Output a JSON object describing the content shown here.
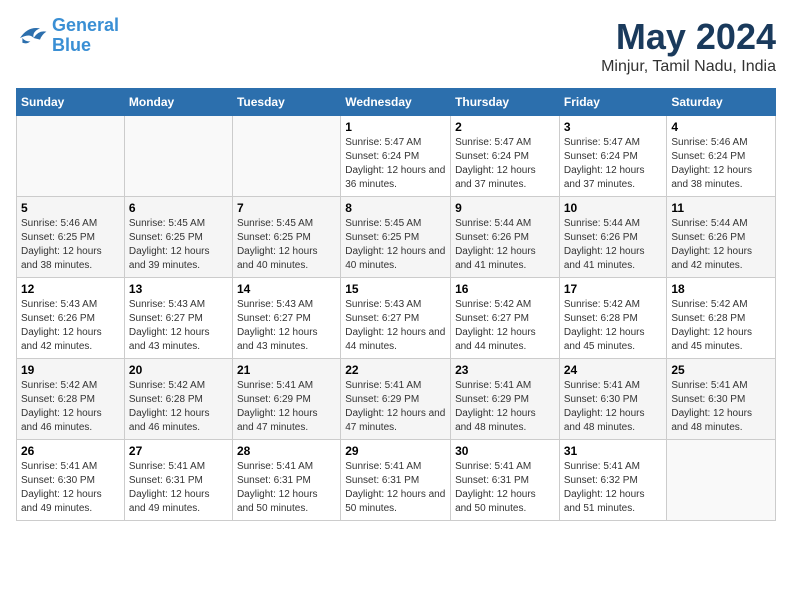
{
  "header": {
    "logo_line1": "General",
    "logo_line2": "Blue",
    "main_title": "May 2024",
    "subtitle": "Minjur, Tamil Nadu, India"
  },
  "weekdays": [
    "Sunday",
    "Monday",
    "Tuesday",
    "Wednesday",
    "Thursday",
    "Friday",
    "Saturday"
  ],
  "weeks": [
    [
      {
        "day": "",
        "sunrise": "",
        "sunset": "",
        "daylight": ""
      },
      {
        "day": "",
        "sunrise": "",
        "sunset": "",
        "daylight": ""
      },
      {
        "day": "",
        "sunrise": "",
        "sunset": "",
        "daylight": ""
      },
      {
        "day": "1",
        "sunrise": "Sunrise: 5:47 AM",
        "sunset": "Sunset: 6:24 PM",
        "daylight": "Daylight: 12 hours and 36 minutes."
      },
      {
        "day": "2",
        "sunrise": "Sunrise: 5:47 AM",
        "sunset": "Sunset: 6:24 PM",
        "daylight": "Daylight: 12 hours and 37 minutes."
      },
      {
        "day": "3",
        "sunrise": "Sunrise: 5:47 AM",
        "sunset": "Sunset: 6:24 PM",
        "daylight": "Daylight: 12 hours and 37 minutes."
      },
      {
        "day": "4",
        "sunrise": "Sunrise: 5:46 AM",
        "sunset": "Sunset: 6:24 PM",
        "daylight": "Daylight: 12 hours and 38 minutes."
      }
    ],
    [
      {
        "day": "5",
        "sunrise": "Sunrise: 5:46 AM",
        "sunset": "Sunset: 6:25 PM",
        "daylight": "Daylight: 12 hours and 38 minutes."
      },
      {
        "day": "6",
        "sunrise": "Sunrise: 5:45 AM",
        "sunset": "Sunset: 6:25 PM",
        "daylight": "Daylight: 12 hours and 39 minutes."
      },
      {
        "day": "7",
        "sunrise": "Sunrise: 5:45 AM",
        "sunset": "Sunset: 6:25 PM",
        "daylight": "Daylight: 12 hours and 40 minutes."
      },
      {
        "day": "8",
        "sunrise": "Sunrise: 5:45 AM",
        "sunset": "Sunset: 6:25 PM",
        "daylight": "Daylight: 12 hours and 40 minutes."
      },
      {
        "day": "9",
        "sunrise": "Sunrise: 5:44 AM",
        "sunset": "Sunset: 6:26 PM",
        "daylight": "Daylight: 12 hours and 41 minutes."
      },
      {
        "day": "10",
        "sunrise": "Sunrise: 5:44 AM",
        "sunset": "Sunset: 6:26 PM",
        "daylight": "Daylight: 12 hours and 41 minutes."
      },
      {
        "day": "11",
        "sunrise": "Sunrise: 5:44 AM",
        "sunset": "Sunset: 6:26 PM",
        "daylight": "Daylight: 12 hours and 42 minutes."
      }
    ],
    [
      {
        "day": "12",
        "sunrise": "Sunrise: 5:43 AM",
        "sunset": "Sunset: 6:26 PM",
        "daylight": "Daylight: 12 hours and 42 minutes."
      },
      {
        "day": "13",
        "sunrise": "Sunrise: 5:43 AM",
        "sunset": "Sunset: 6:27 PM",
        "daylight": "Daylight: 12 hours and 43 minutes."
      },
      {
        "day": "14",
        "sunrise": "Sunrise: 5:43 AM",
        "sunset": "Sunset: 6:27 PM",
        "daylight": "Daylight: 12 hours and 43 minutes."
      },
      {
        "day": "15",
        "sunrise": "Sunrise: 5:43 AM",
        "sunset": "Sunset: 6:27 PM",
        "daylight": "Daylight: 12 hours and 44 minutes."
      },
      {
        "day": "16",
        "sunrise": "Sunrise: 5:42 AM",
        "sunset": "Sunset: 6:27 PM",
        "daylight": "Daylight: 12 hours and 44 minutes."
      },
      {
        "day": "17",
        "sunrise": "Sunrise: 5:42 AM",
        "sunset": "Sunset: 6:28 PM",
        "daylight": "Daylight: 12 hours and 45 minutes."
      },
      {
        "day": "18",
        "sunrise": "Sunrise: 5:42 AM",
        "sunset": "Sunset: 6:28 PM",
        "daylight": "Daylight: 12 hours and 45 minutes."
      }
    ],
    [
      {
        "day": "19",
        "sunrise": "Sunrise: 5:42 AM",
        "sunset": "Sunset: 6:28 PM",
        "daylight": "Daylight: 12 hours and 46 minutes."
      },
      {
        "day": "20",
        "sunrise": "Sunrise: 5:42 AM",
        "sunset": "Sunset: 6:28 PM",
        "daylight": "Daylight: 12 hours and 46 minutes."
      },
      {
        "day": "21",
        "sunrise": "Sunrise: 5:41 AM",
        "sunset": "Sunset: 6:29 PM",
        "daylight": "Daylight: 12 hours and 47 minutes."
      },
      {
        "day": "22",
        "sunrise": "Sunrise: 5:41 AM",
        "sunset": "Sunset: 6:29 PM",
        "daylight": "Daylight: 12 hours and 47 minutes."
      },
      {
        "day": "23",
        "sunrise": "Sunrise: 5:41 AM",
        "sunset": "Sunset: 6:29 PM",
        "daylight": "Daylight: 12 hours and 48 minutes."
      },
      {
        "day": "24",
        "sunrise": "Sunrise: 5:41 AM",
        "sunset": "Sunset: 6:30 PM",
        "daylight": "Daylight: 12 hours and 48 minutes."
      },
      {
        "day": "25",
        "sunrise": "Sunrise: 5:41 AM",
        "sunset": "Sunset: 6:30 PM",
        "daylight": "Daylight: 12 hours and 48 minutes."
      }
    ],
    [
      {
        "day": "26",
        "sunrise": "Sunrise: 5:41 AM",
        "sunset": "Sunset: 6:30 PM",
        "daylight": "Daylight: 12 hours and 49 minutes."
      },
      {
        "day": "27",
        "sunrise": "Sunrise: 5:41 AM",
        "sunset": "Sunset: 6:31 PM",
        "daylight": "Daylight: 12 hours and 49 minutes."
      },
      {
        "day": "28",
        "sunrise": "Sunrise: 5:41 AM",
        "sunset": "Sunset: 6:31 PM",
        "daylight": "Daylight: 12 hours and 50 minutes."
      },
      {
        "day": "29",
        "sunrise": "Sunrise: 5:41 AM",
        "sunset": "Sunset: 6:31 PM",
        "daylight": "Daylight: 12 hours and 50 minutes."
      },
      {
        "day": "30",
        "sunrise": "Sunrise: 5:41 AM",
        "sunset": "Sunset: 6:31 PM",
        "daylight": "Daylight: 12 hours and 50 minutes."
      },
      {
        "day": "31",
        "sunrise": "Sunrise: 5:41 AM",
        "sunset": "Sunset: 6:32 PM",
        "daylight": "Daylight: 12 hours and 51 minutes."
      },
      {
        "day": "",
        "sunrise": "",
        "sunset": "",
        "daylight": ""
      }
    ]
  ]
}
